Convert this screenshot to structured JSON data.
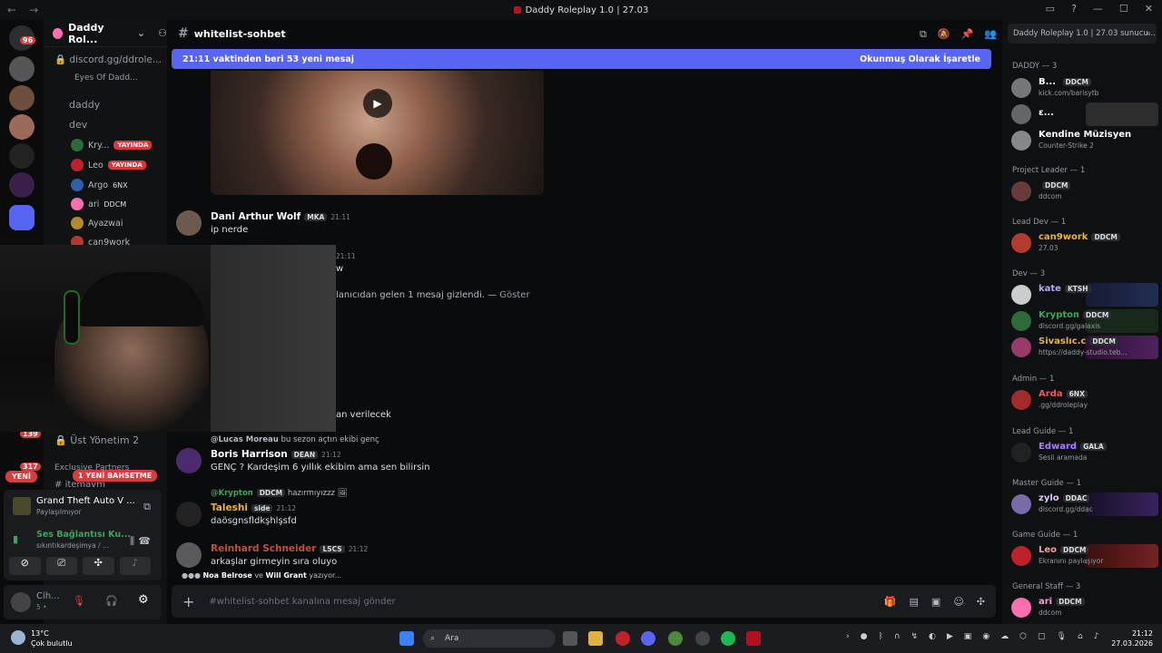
{
  "window": {
    "title": "Daddy Roleplay 1.0 | 27.03",
    "nav_back": "←",
    "nav_forward": "→"
  },
  "rail": {
    "badges": [
      "96",
      "139",
      "317"
    ],
    "new_label": "YENİ"
  },
  "sidebar": {
    "server_name": "Daddy Rol...",
    "channels": [
      {
        "label": "discord.gg/ddrole..."
      },
      {
        "label": "Eyes Of Dadd..."
      },
      {
        "label": "daddy"
      },
      {
        "label": "dev"
      }
    ],
    "voice_users": [
      {
        "name": "Kry...",
        "badge": "YAYINDA"
      },
      {
        "name": "Leo",
        "badge": "YAYINDA"
      },
      {
        "name": "Argo",
        "badge": "6NX"
      },
      {
        "name": "ari",
        "badge": "DDCM"
      },
      {
        "name": "Ayazwai",
        "badge": ""
      },
      {
        "name": "can9work",
        "badge": ""
      }
    ],
    "ust_yonetim": "Üst Yönetim 2",
    "exclusive": "Exclusive Partners",
    "itemavm": "itemavm",
    "yeni_bahsetme": "1 YENİ BAHSETME"
  },
  "activity": {
    "game": "Grand Theft Auto V ...",
    "game_status": "Paylaşılmıyor",
    "voice": "Ses Bağlantısı Ku...",
    "voice_sub": "sıkıntıkardeşimya / ..."
  },
  "usercard": {
    "name": "Cih...",
    "status": "5 •"
  },
  "channel": {
    "name": "whitelist-sohbet",
    "new_messages": "21:11 vaktinden beri 53 yeni mesaj",
    "mark_read": "Okunmuş Olarak İşaretle",
    "composer_placeholder": "#whitelist-sohbet kanalına mesaj gönder"
  },
  "messages": [
    {
      "user": "Dani Arthur Wolf",
      "tag": "MKA",
      "time": "21:11",
      "text": "ip nerde",
      "color": "#ffffff"
    },
    {
      "user": "Boris Harrison",
      "tag": "DEAN",
      "time": "21:12",
      "text": "GENÇ ? Kardeşim 6 yıllık ekibim ama sen bilirsin",
      "color": "#ffffff",
      "reply_user": "@Lucas Moreau",
      "reply_text": "bu sezon açtın ekibi genç"
    },
    {
      "user": "Taleshi",
      "tag": "side",
      "time": "21:12",
      "text": "daösgnsfldkşhlşsfd",
      "color": "#f0b232",
      "reply_user": "@Kryptoп",
      "reply_tag": "DDCM",
      "reply_text": "hazırmıyızzz"
    },
    {
      "user": "Reinhard Schneider",
      "tag": "LSCS",
      "time": "21:12",
      "text": "arkaşlar girmeyin sıra oluyo",
      "color": "#c0503c"
    }
  ],
  "partials": {
    "time_2111": "21:11",
    "w": "w",
    "hidden": "lanıcıdan gelen 1 mesaj gizlendi. —",
    "goster": "Göster",
    "verilecek": "an verilecek"
  },
  "typing": {
    "user1": "Noa Belrose",
    "and": "ve",
    "user2": "Will Grant",
    "suffix": "yazıyor..."
  },
  "members": {
    "search": "Daddy Roleplay 1.0 | 27.03 sunucu...",
    "groups": [
      {
        "label": "DADDY — 3"
      },
      {
        "label": "Project Leader — 1"
      },
      {
        "label": "Lead Dev — 1"
      },
      {
        "label": "Dev — 3"
      },
      {
        "label": "Admin — 1"
      },
      {
        "label": "Lead Guide — 1"
      },
      {
        "label": "Master Guide — 1"
      },
      {
        "label": "Game Guide — 1"
      },
      {
        "label": "General Staff — 3"
      }
    ],
    "list": [
      {
        "name": "B...",
        "tag": "DDCM",
        "status": "kick.com/barisytb",
        "color": "#ffffff"
      },
      {
        "name": "ε...",
        "tag": "",
        "status": "",
        "color": "#ffffff"
      },
      {
        "name": "Kendine Müzisyen",
        "tag": "",
        "status": "Counter-Strike 2",
        "color": "#ffffff"
      },
      {
        "name": "",
        "tag": "DDCM",
        "status": "ddcom",
        "color": "#ffffff"
      },
      {
        "name": "can9work",
        "tag": "DDCM",
        "status": "27.03",
        "color": "#f0b232"
      },
      {
        "name": "kate",
        "tag": "KTSH",
        "status": "",
        "color": "#b5a8ff"
      },
      {
        "name": "Kryptoп",
        "tag": "DDCM",
        "status": "discord.gg/galaxis",
        "color": "#3ba55c"
      },
      {
        "name": "Sivaslıc.c",
        "tag": "DDCM",
        "status": "https://daddy-studio.teb...",
        "color": "#f0b232"
      },
      {
        "name": "Arda",
        "tag": "6NX",
        "status": ".gg/ddroleplay",
        "color": "#e8585e"
      },
      {
        "name": "Edward",
        "tag": "GALA",
        "status": "Sesli aramada",
        "color": "#b07cff"
      },
      {
        "name": "zylo",
        "tag": "DDAC",
        "status": "discord.gg/ddac",
        "color": "#e0c3ff"
      },
      {
        "name": "Leo",
        "tag": "DDCM",
        "status": "Ekranını paylaşıyor",
        "color": "#f0a0a0"
      },
      {
        "name": "ari",
        "tag": "DDCM",
        "status": "ddcom",
        "color": "#ff9ce0"
      }
    ]
  },
  "taskbar": {
    "temp": "13°C",
    "weather": "Çok bulutlu",
    "search": "Ara",
    "time": "21:12",
    "date": "27.03.2026"
  }
}
